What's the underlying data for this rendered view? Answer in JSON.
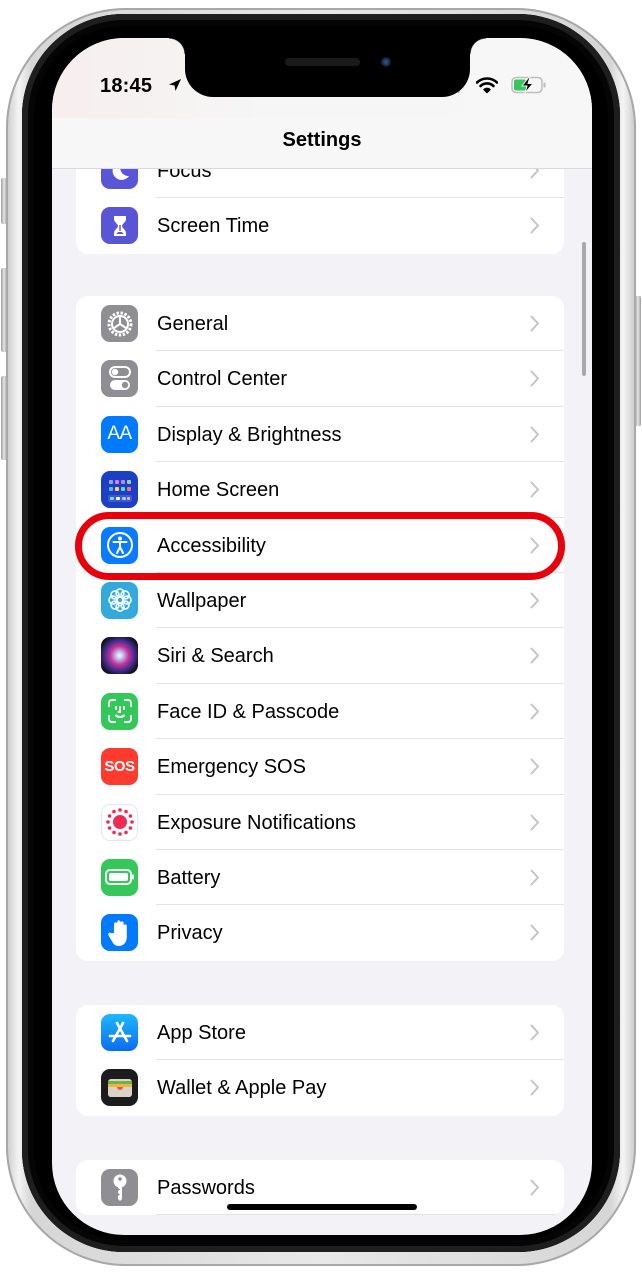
{
  "status_bar": {
    "time": "18:45",
    "location_icon": "location-arrow-icon",
    "signal_icon": "cellular-signal-icon",
    "wifi_icon": "wifi-icon",
    "battery_icon": "battery-charging-icon",
    "battery_level": 0.4,
    "battery_color": "#34c759"
  },
  "nav": {
    "title": "Settings"
  },
  "groups": [
    {
      "rows": [
        {
          "label": "Focus",
          "icon": "focus-moon-icon",
          "icon_bg": "#5856d6"
        },
        {
          "label": "Screen Time",
          "icon": "hourglass-icon",
          "icon_bg": "#5856d6"
        }
      ]
    },
    {
      "rows": [
        {
          "label": "General",
          "icon": "gear-icon",
          "icon_bg": "#8e8e93"
        },
        {
          "label": "Control Center",
          "icon": "toggles-icon",
          "icon_bg": "#8e8e93"
        },
        {
          "label": "Display & Brightness",
          "icon": "text-size-icon",
          "icon_bg": "#007aff",
          "icon_text": "AA"
        },
        {
          "label": "Home Screen",
          "icon": "app-grid-icon",
          "icon_bg": "#1d3fc4"
        },
        {
          "label": "Accessibility",
          "icon": "accessibility-person-icon",
          "icon_bg": "#0a7aff",
          "highlighted": true
        },
        {
          "label": "Wallpaper",
          "icon": "flower-icon",
          "icon_bg": "#34aadc"
        },
        {
          "label": "Siri & Search",
          "icon": "siri-orb-icon",
          "icon_bg": "#1c1c1e"
        },
        {
          "label": "Face ID & Passcode",
          "icon": "face-id-icon",
          "icon_bg": "#34c759"
        },
        {
          "label": "Emergency SOS",
          "icon": "sos-icon",
          "icon_bg": "#ff3b30",
          "icon_text": "SOS"
        },
        {
          "label": "Exposure Notifications",
          "icon": "exposure-sun-icon",
          "icon_bg": "#ffffff"
        },
        {
          "label": "Battery",
          "icon": "battery-icon",
          "icon_bg": "#34c759"
        },
        {
          "label": "Privacy",
          "icon": "hand-icon",
          "icon_bg": "#007aff"
        }
      ]
    },
    {
      "rows": [
        {
          "label": "App Store",
          "icon": "app-store-icon",
          "icon_bg": "#0a84ff"
        },
        {
          "label": "Wallet & Apple Pay",
          "icon": "wallet-icon",
          "icon_bg": "#1c1c1e"
        }
      ]
    },
    {
      "rows": [
        {
          "label": "Passwords",
          "icon": "key-icon",
          "icon_bg": "#8e8e93"
        }
      ]
    }
  ],
  "annotation": {
    "highlight_target": "Accessibility",
    "highlight_color": "#e8000b"
  }
}
